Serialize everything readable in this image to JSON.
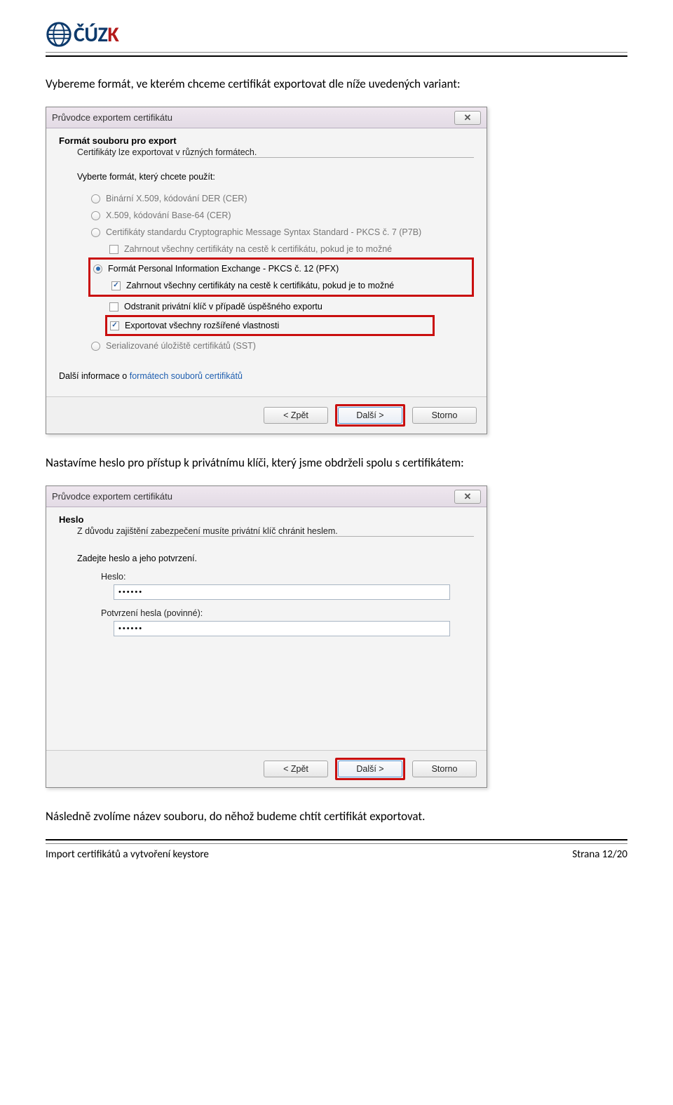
{
  "logo": {
    "text_prefix": "ČÚZ",
    "text_suffix": "K"
  },
  "paragraphs": {
    "p1": "Vybereme formát, ve kterém chceme certifikát exportovat dle níže uvedených variant:",
    "p2": "Nastavíme heslo pro přístup k privátnímu klíči, který jsme obdrželi spolu s certifikátem:",
    "p3": "Následně zvolíme název souboru, do něhož budeme chtít certifikát exportovat."
  },
  "dialog1": {
    "title": "Průvodce exportem certifikátu",
    "section": "Formát souboru pro export",
    "section_sub": "Certifikáty lze exportovat v různých formátech.",
    "prompt": "Vyberte formát, který chcete použít:",
    "opt1": "Binární X.509, kódování DER (CER)",
    "opt2": "X.509, kódování Base-64 (CER)",
    "opt3": "Certifikáty standardu Cryptographic Message Syntax Standard - PKCS č. 7 (P7B)",
    "opt3a": "Zahrnout všechny certifikáty na cestě k certifikátu, pokud je to možné",
    "opt4": "Formát Personal Information Exchange - PKCS č. 12 (PFX)",
    "opt4a": "Zahrnout všechny certifikáty na cestě k certifikátu, pokud je to možné",
    "opt4b": "Odstranit privátní klíč v případě úspěšného exportu",
    "opt4c": "Exportovat všechny rozšířené vlastnosti",
    "opt5": "Serializované úložiště certifikátů (SST)",
    "link_prefix": "Další informace o ",
    "link": "formátech souborů certifikátů",
    "btn_back": "< Zpět",
    "btn_next": "Další >",
    "btn_cancel": "Storno"
  },
  "dialog2": {
    "title": "Průvodce exportem certifikátu",
    "section": "Heslo",
    "section_sub": "Z důvodu zajištění zabezpečení musíte privátní klíč chránit heslem.",
    "prompt": "Zadejte heslo a jeho potvrzení.",
    "label1": "Heslo:",
    "value1": "••••••",
    "label2": "Potvrzení hesla (povinné):",
    "value2": "••••••",
    "btn_back": "< Zpět",
    "btn_next": "Další >",
    "btn_cancel": "Storno"
  },
  "footer": {
    "left": "Import certifikátů a vytvoření keystore",
    "right": "Strana 12/20"
  }
}
